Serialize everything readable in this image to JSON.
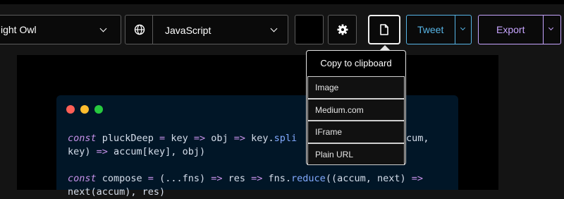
{
  "toolbar": {
    "theme_value": "ight Owl",
    "language_value": "JavaScript",
    "tweet_label": "Tweet",
    "export_label": "Export"
  },
  "copy_menu": {
    "heading": "Copy to clipboard",
    "items": [
      "Image",
      "Medium.com",
      "IFrame",
      "Plain URL"
    ]
  },
  "window_controls": {
    "colors": [
      "#ff5f56",
      "#ffbd2e",
      "#27c93f"
    ]
  },
  "code": {
    "lines": [
      [
        [
          "kw",
          "const"
        ],
        [
          "t",
          " pluckDeep "
        ],
        [
          "op",
          "="
        ],
        [
          "t",
          " key "
        ],
        [
          "op",
          "=>"
        ],
        [
          "t",
          " obj "
        ],
        [
          "op",
          "=>"
        ],
        [
          "t",
          " key."
        ],
        [
          "fn",
          "spli"
        ]
      ],
      [
        [
          "t",
          "key) "
        ],
        [
          "op",
          "=>"
        ],
        [
          "t",
          " accum[key], obj)"
        ]
      ],
      [
        [
          "t",
          ""
        ]
      ],
      [
        [
          "kw",
          "const"
        ],
        [
          "t",
          " compose "
        ],
        [
          "op",
          "="
        ],
        [
          "t",
          " (...fns) "
        ],
        [
          "op",
          "=>"
        ],
        [
          "t",
          " res "
        ],
        [
          "op",
          "=>"
        ],
        [
          "t",
          " fns."
        ],
        [
          "fn",
          "reduce"
        ],
        [
          "t",
          "((accum, next) "
        ],
        [
          "op",
          "=>"
        ]
      ],
      [
        [
          "t",
          "next(accum), res)"
        ]
      ]
    ],
    "overflow_text": "cum,"
  },
  "colors": {
    "accent_blue": "#57b5e6",
    "accent_purple": "#c7a5ff",
    "code_bg": "#011627"
  }
}
